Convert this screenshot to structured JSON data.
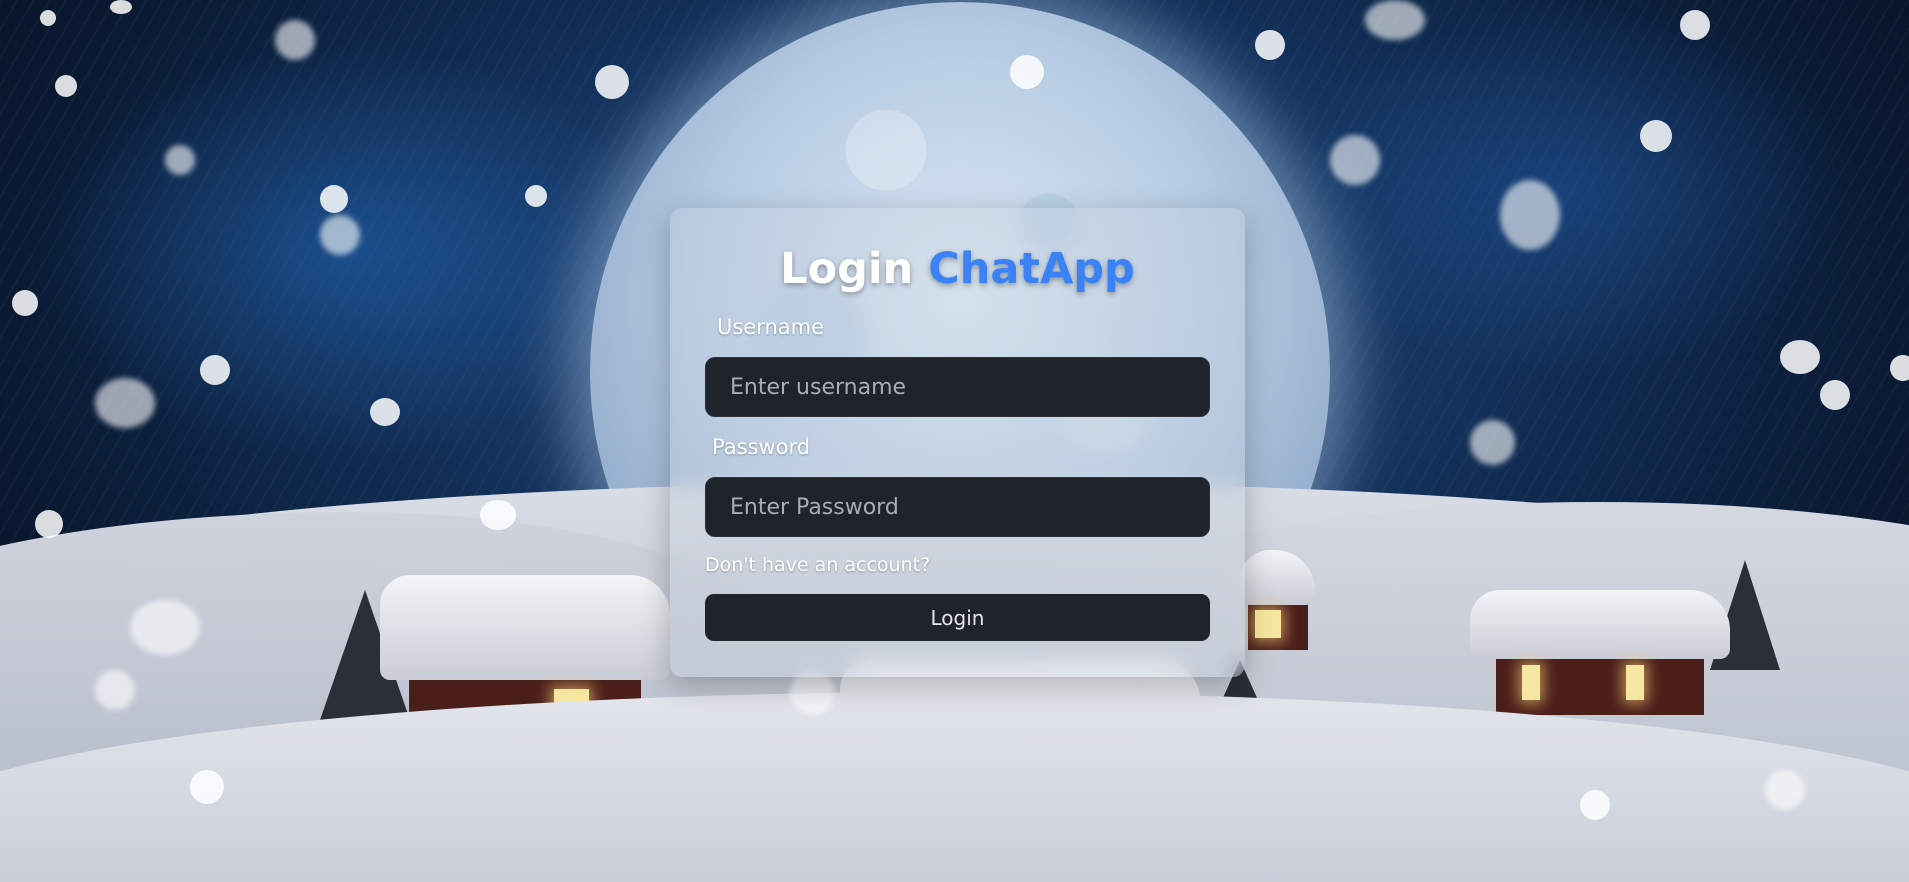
{
  "login": {
    "title_prefix": "Login",
    "title_accent": "ChatApp",
    "username_label": "Username",
    "username_placeholder": "Enter username",
    "username_value": "",
    "password_label": "Password",
    "password_placeholder": "Enter Password",
    "password_value": "",
    "signup_link": "Don't have an account?",
    "submit_label": "Login"
  },
  "colors": {
    "accent": "#3b82f6",
    "field_bg": "#1f232b",
    "card_bg": "rgba(200,208,220,0.35)"
  },
  "background": {
    "scene": "winter-night-moon-village"
  }
}
